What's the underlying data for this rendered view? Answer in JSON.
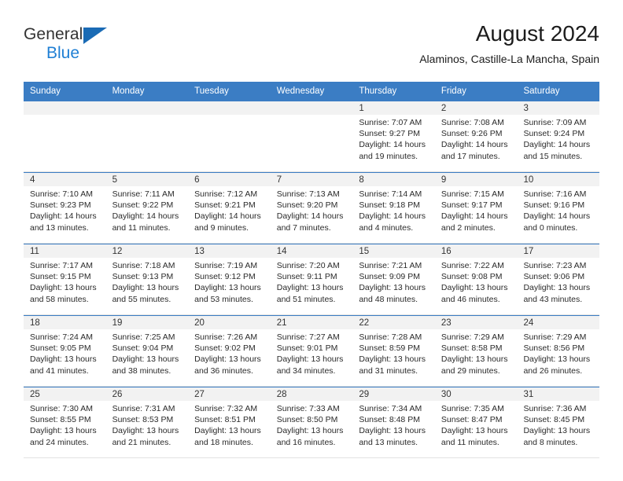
{
  "brand": {
    "name_part1": "General",
    "name_part2": "Blue",
    "accent_color": "#1f7fd4",
    "triangle_color": "#1a6bb5",
    "triangle_icon": "triangle-logo-icon"
  },
  "header": {
    "title": "August 2024",
    "subtitle": "Alaminos, Castille-La Mancha, Spain"
  },
  "calendar": {
    "header_bg": "#3b7dc4",
    "weekdays": [
      "Sunday",
      "Monday",
      "Tuesday",
      "Wednesday",
      "Thursday",
      "Friday",
      "Saturday"
    ],
    "labels": {
      "sunrise": "Sunrise:",
      "sunset": "Sunset:",
      "daylight": "Daylight:"
    },
    "weeks": [
      [
        {
          "day": "",
          "sunrise": "",
          "sunset": "",
          "daylight": "",
          "empty": true
        },
        {
          "day": "",
          "sunrise": "",
          "sunset": "",
          "daylight": "",
          "empty": true
        },
        {
          "day": "",
          "sunrise": "",
          "sunset": "",
          "daylight": "",
          "empty": true
        },
        {
          "day": "",
          "sunrise": "",
          "sunset": "",
          "daylight": "",
          "empty": true
        },
        {
          "day": "1",
          "sunrise": "Sunrise: 7:07 AM",
          "sunset": "Sunset: 9:27 PM",
          "daylight": "Daylight: 14 hours and 19 minutes.",
          "empty": false
        },
        {
          "day": "2",
          "sunrise": "Sunrise: 7:08 AM",
          "sunset": "Sunset: 9:26 PM",
          "daylight": "Daylight: 14 hours and 17 minutes.",
          "empty": false
        },
        {
          "day": "3",
          "sunrise": "Sunrise: 7:09 AM",
          "sunset": "Sunset: 9:24 PM",
          "daylight": "Daylight: 14 hours and 15 minutes.",
          "empty": false
        }
      ],
      [
        {
          "day": "4",
          "sunrise": "Sunrise: 7:10 AM",
          "sunset": "Sunset: 9:23 PM",
          "daylight": "Daylight: 14 hours and 13 minutes.",
          "empty": false
        },
        {
          "day": "5",
          "sunrise": "Sunrise: 7:11 AM",
          "sunset": "Sunset: 9:22 PM",
          "daylight": "Daylight: 14 hours and 11 minutes.",
          "empty": false
        },
        {
          "day": "6",
          "sunrise": "Sunrise: 7:12 AM",
          "sunset": "Sunset: 9:21 PM",
          "daylight": "Daylight: 14 hours and 9 minutes.",
          "empty": false
        },
        {
          "day": "7",
          "sunrise": "Sunrise: 7:13 AM",
          "sunset": "Sunset: 9:20 PM",
          "daylight": "Daylight: 14 hours and 7 minutes.",
          "empty": false
        },
        {
          "day": "8",
          "sunrise": "Sunrise: 7:14 AM",
          "sunset": "Sunset: 9:18 PM",
          "daylight": "Daylight: 14 hours and 4 minutes.",
          "empty": false
        },
        {
          "day": "9",
          "sunrise": "Sunrise: 7:15 AM",
          "sunset": "Sunset: 9:17 PM",
          "daylight": "Daylight: 14 hours and 2 minutes.",
          "empty": false
        },
        {
          "day": "10",
          "sunrise": "Sunrise: 7:16 AM",
          "sunset": "Sunset: 9:16 PM",
          "daylight": "Daylight: 14 hours and 0 minutes.",
          "empty": false
        }
      ],
      [
        {
          "day": "11",
          "sunrise": "Sunrise: 7:17 AM",
          "sunset": "Sunset: 9:15 PM",
          "daylight": "Daylight: 13 hours and 58 minutes.",
          "empty": false
        },
        {
          "day": "12",
          "sunrise": "Sunrise: 7:18 AM",
          "sunset": "Sunset: 9:13 PM",
          "daylight": "Daylight: 13 hours and 55 minutes.",
          "empty": false
        },
        {
          "day": "13",
          "sunrise": "Sunrise: 7:19 AM",
          "sunset": "Sunset: 9:12 PM",
          "daylight": "Daylight: 13 hours and 53 minutes.",
          "empty": false
        },
        {
          "day": "14",
          "sunrise": "Sunrise: 7:20 AM",
          "sunset": "Sunset: 9:11 PM",
          "daylight": "Daylight: 13 hours and 51 minutes.",
          "empty": false
        },
        {
          "day": "15",
          "sunrise": "Sunrise: 7:21 AM",
          "sunset": "Sunset: 9:09 PM",
          "daylight": "Daylight: 13 hours and 48 minutes.",
          "empty": false
        },
        {
          "day": "16",
          "sunrise": "Sunrise: 7:22 AM",
          "sunset": "Sunset: 9:08 PM",
          "daylight": "Daylight: 13 hours and 46 minutes.",
          "empty": false
        },
        {
          "day": "17",
          "sunrise": "Sunrise: 7:23 AM",
          "sunset": "Sunset: 9:06 PM",
          "daylight": "Daylight: 13 hours and 43 minutes.",
          "empty": false
        }
      ],
      [
        {
          "day": "18",
          "sunrise": "Sunrise: 7:24 AM",
          "sunset": "Sunset: 9:05 PM",
          "daylight": "Daylight: 13 hours and 41 minutes.",
          "empty": false
        },
        {
          "day": "19",
          "sunrise": "Sunrise: 7:25 AM",
          "sunset": "Sunset: 9:04 PM",
          "daylight": "Daylight: 13 hours and 38 minutes.",
          "empty": false
        },
        {
          "day": "20",
          "sunrise": "Sunrise: 7:26 AM",
          "sunset": "Sunset: 9:02 PM",
          "daylight": "Daylight: 13 hours and 36 minutes.",
          "empty": false
        },
        {
          "day": "21",
          "sunrise": "Sunrise: 7:27 AM",
          "sunset": "Sunset: 9:01 PM",
          "daylight": "Daylight: 13 hours and 34 minutes.",
          "empty": false
        },
        {
          "day": "22",
          "sunrise": "Sunrise: 7:28 AM",
          "sunset": "Sunset: 8:59 PM",
          "daylight": "Daylight: 13 hours and 31 minutes.",
          "empty": false
        },
        {
          "day": "23",
          "sunrise": "Sunrise: 7:29 AM",
          "sunset": "Sunset: 8:58 PM",
          "daylight": "Daylight: 13 hours and 29 minutes.",
          "empty": false
        },
        {
          "day": "24",
          "sunrise": "Sunrise: 7:29 AM",
          "sunset": "Sunset: 8:56 PM",
          "daylight": "Daylight: 13 hours and 26 minutes.",
          "empty": false
        }
      ],
      [
        {
          "day": "25",
          "sunrise": "Sunrise: 7:30 AM",
          "sunset": "Sunset: 8:55 PM",
          "daylight": "Daylight: 13 hours and 24 minutes.",
          "empty": false
        },
        {
          "day": "26",
          "sunrise": "Sunrise: 7:31 AM",
          "sunset": "Sunset: 8:53 PM",
          "daylight": "Daylight: 13 hours and 21 minutes.",
          "empty": false
        },
        {
          "day": "27",
          "sunrise": "Sunrise: 7:32 AM",
          "sunset": "Sunset: 8:51 PM",
          "daylight": "Daylight: 13 hours and 18 minutes.",
          "empty": false
        },
        {
          "day": "28",
          "sunrise": "Sunrise: 7:33 AM",
          "sunset": "Sunset: 8:50 PM",
          "daylight": "Daylight: 13 hours and 16 minutes.",
          "empty": false
        },
        {
          "day": "29",
          "sunrise": "Sunrise: 7:34 AM",
          "sunset": "Sunset: 8:48 PM",
          "daylight": "Daylight: 13 hours and 13 minutes.",
          "empty": false
        },
        {
          "day": "30",
          "sunrise": "Sunrise: 7:35 AM",
          "sunset": "Sunset: 8:47 PM",
          "daylight": "Daylight: 13 hours and 11 minutes.",
          "empty": false
        },
        {
          "day": "31",
          "sunrise": "Sunrise: 7:36 AM",
          "sunset": "Sunset: 8:45 PM",
          "daylight": "Daylight: 13 hours and 8 minutes.",
          "empty": false
        }
      ]
    ]
  }
}
